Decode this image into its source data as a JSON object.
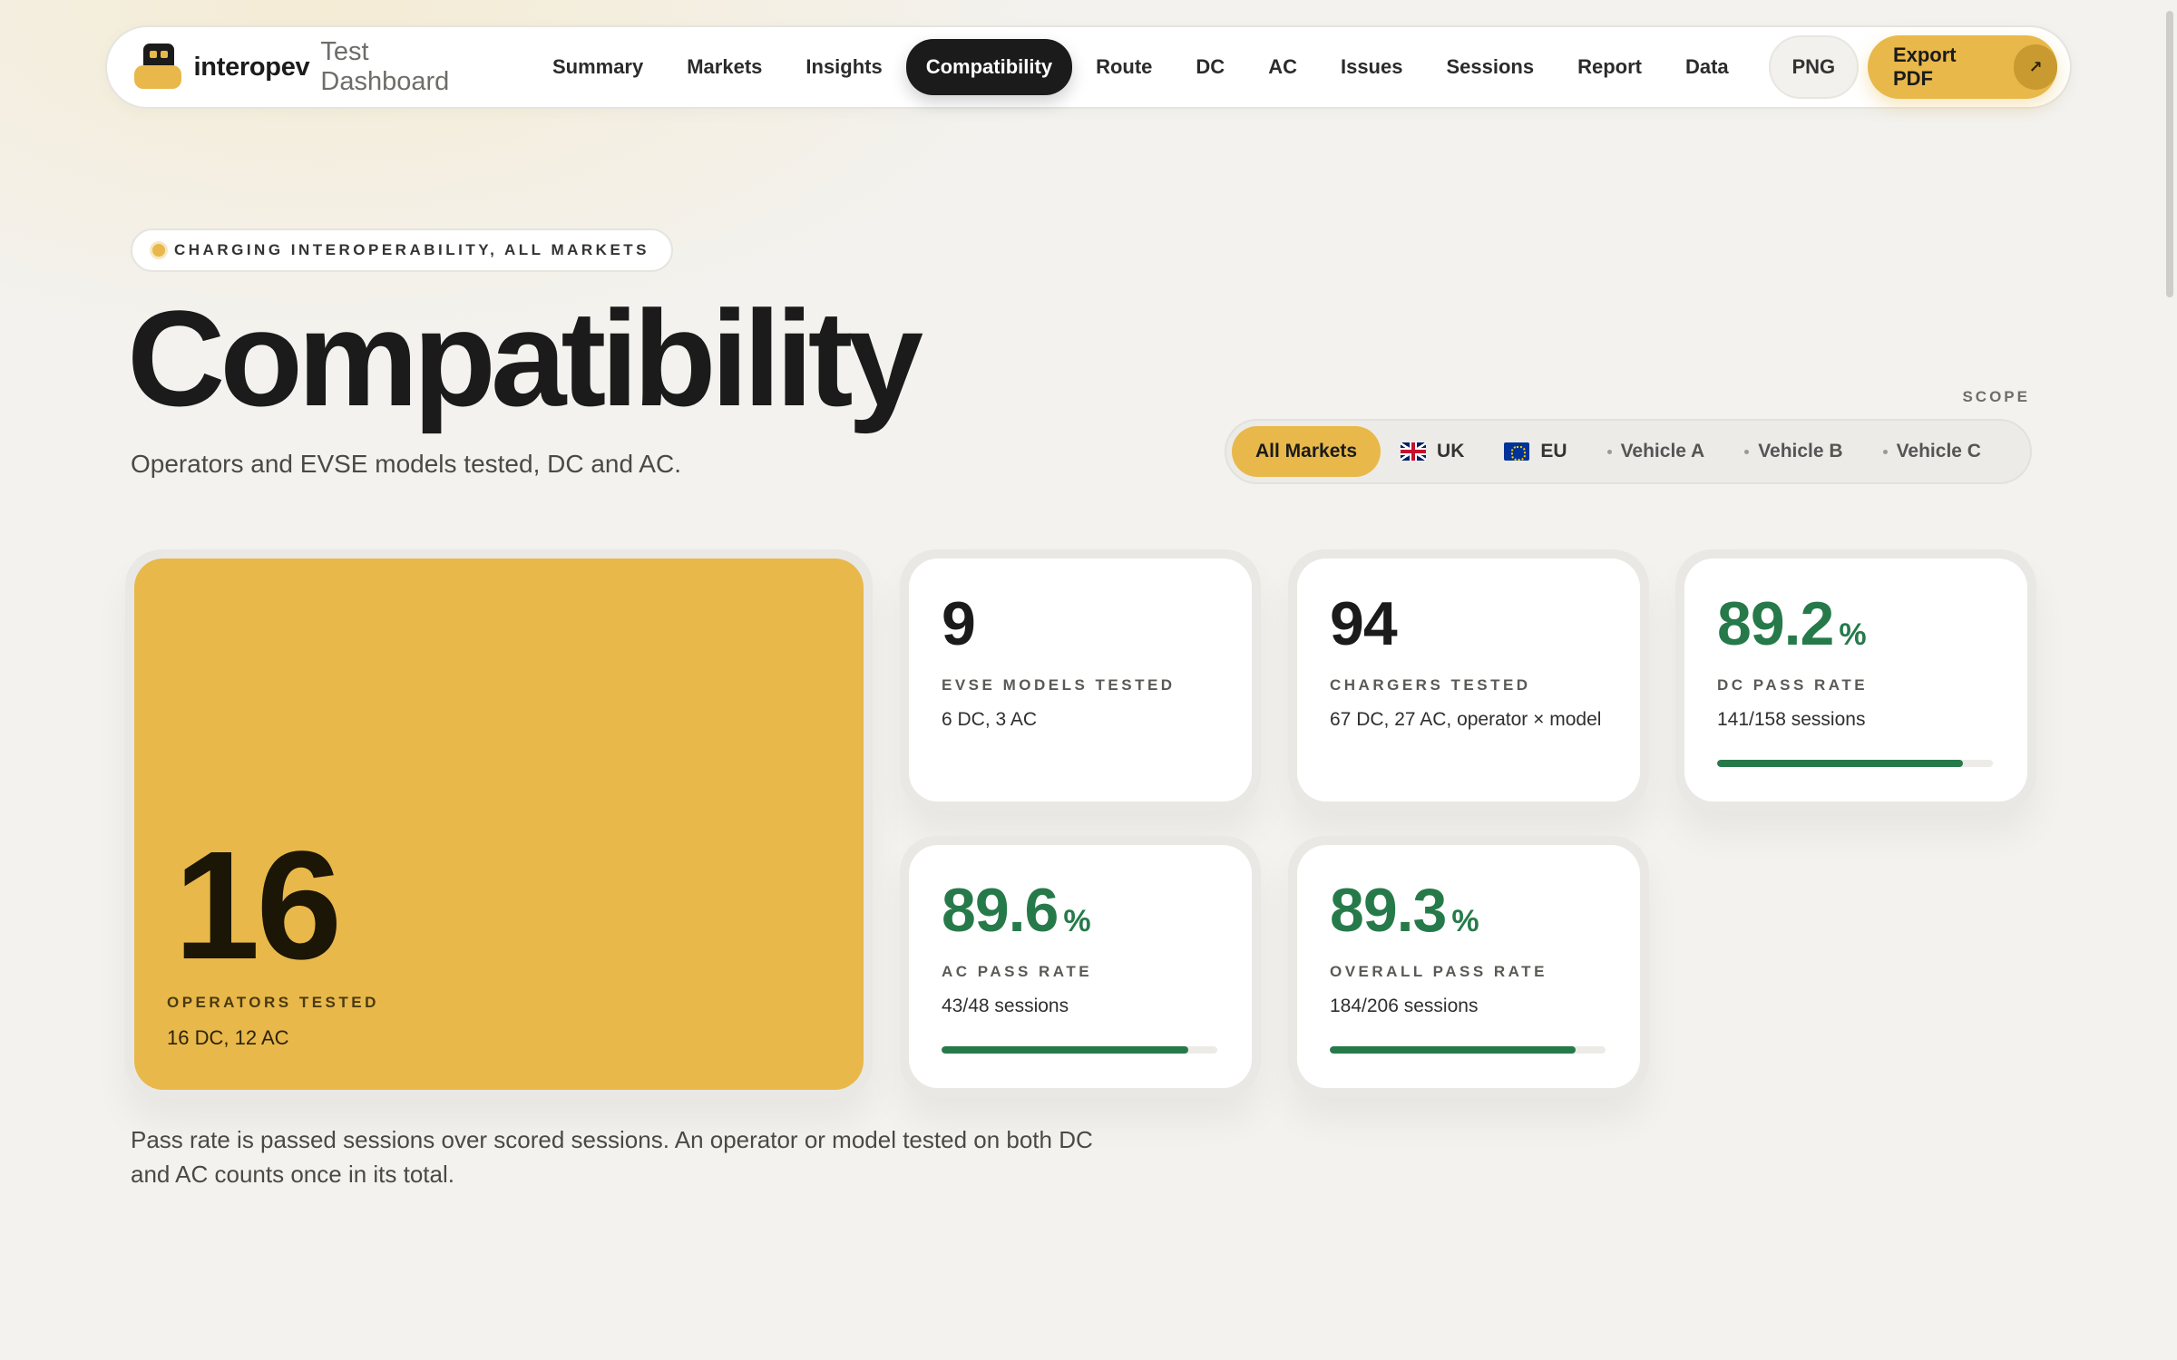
{
  "nav": {
    "brand": "interopev",
    "brand_suffix": "Test Dashboard",
    "links": [
      "Summary",
      "Markets",
      "Insights",
      "Compatibility",
      "Route",
      "DC",
      "AC",
      "Issues",
      "Sessions",
      "Report",
      "Data"
    ],
    "active": "Compatibility",
    "png_label": "PNG",
    "export_label": "Export PDF",
    "export_icon": "↗"
  },
  "header": {
    "eyebrow": "CHARGING INTEROPERABILITY, ALL MARKETS",
    "title": "Compatibility",
    "subtitle": "Operators and EVSE models tested, DC and AC."
  },
  "scope": {
    "label": "SCOPE",
    "options": [
      {
        "label": "All Markets",
        "active": true
      },
      {
        "label": "UK",
        "flag": "uk-flag-icon"
      },
      {
        "label": "EU",
        "flag": "eu-flag-icon"
      },
      {
        "label": "Vehicle A"
      },
      {
        "label": "Vehicle B"
      },
      {
        "label": "Vehicle C"
      }
    ]
  },
  "stats": {
    "operators": {
      "value": "16",
      "label": "OPERATORS TESTED",
      "sub": "16 DC, 12 AC"
    },
    "evse_models": {
      "value": "9",
      "label": "EVSE MODELS TESTED",
      "sub": "6 DC, 3 AC"
    },
    "chargers": {
      "value": "94",
      "label": "CHARGERS TESTED",
      "sub": "67 DC, 27 AC, operator × model"
    },
    "dc_pass": {
      "value": "89.2",
      "unit": "%",
      "label": "DC PASS RATE",
      "sub": "141/158 sessions",
      "progress": 0.892
    },
    "ac_pass": {
      "value": "89.6",
      "unit": "%",
      "label": "AC PASS RATE",
      "sub": "43/48 sessions",
      "progress": 0.896
    },
    "overall_pass": {
      "value": "89.3",
      "unit": "%",
      "label": "OVERALL PASS RATE",
      "sub": "184/206 sessions",
      "progress": 0.893
    }
  },
  "footnote": "Pass rate is passed sessions over scored sessions. An operator or model tested on both DC and AC counts once in its total.",
  "colors": {
    "accent": "#e8b84a",
    "success": "#267a4a",
    "dark": "#1b1b1b",
    "background": "#f3f2ef"
  }
}
